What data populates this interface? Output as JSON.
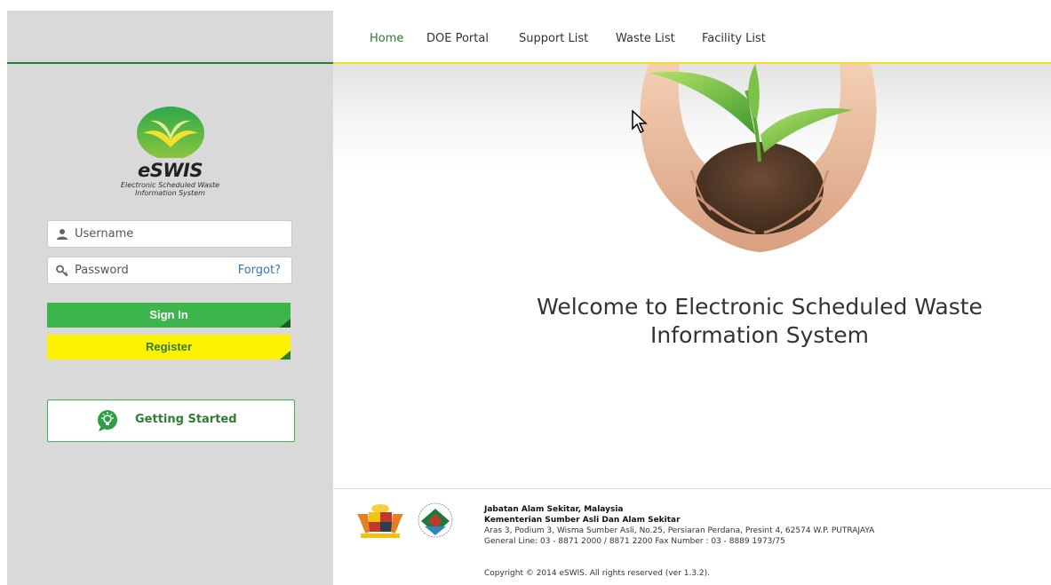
{
  "nav": {
    "items": [
      {
        "label": "Home",
        "active": true
      },
      {
        "label": "DOE Portal"
      },
      {
        "label": "Support List"
      },
      {
        "label": "Waste List"
      },
      {
        "label": "Facility List"
      }
    ]
  },
  "brand": {
    "name": "eSWIS",
    "tagline_line1": "Electronic Scheduled Waste",
    "tagline_line2": "Information System",
    "logo_icon": "eswis-leaf-logo"
  },
  "login": {
    "username_placeholder": "Username",
    "password_placeholder": "Password",
    "forgot_label": "Forgot?",
    "signin_label": "Sign In",
    "register_label": "Register",
    "getting_started_label": "Getting Started"
  },
  "hero": {
    "welcome_line1": "Welcome to Electronic Scheduled Waste",
    "welcome_line2": "Information System",
    "image_icon": "hands-holding-seedling"
  },
  "footer": {
    "org_name": "Jabatan Alam Sekitar, Malaysia",
    "ministry": "Kementerian Sumber Asli Dan Alam Sekitar",
    "address": "Aras 3, Podium 3, Wisma Sumber Asli, No.25, Persiaran Perdana, Presint 4, 62574 W.P. PUTRAJAYA",
    "phone": "General Line: 03 - 8871 2000 / 8871 2200 Fax Number : 03 - 8889 1973/75",
    "copyright": "Copyright © 2014 eSWIS. All rights reserved (ver 1.3.2)."
  },
  "colors": {
    "accent_green": "#3cb54a",
    "register_yellow": "#fff200",
    "link_blue": "#3a73b8",
    "nav_rule_yellow": "#f5dd20",
    "sidebar_bg": "#d9d9d9"
  }
}
